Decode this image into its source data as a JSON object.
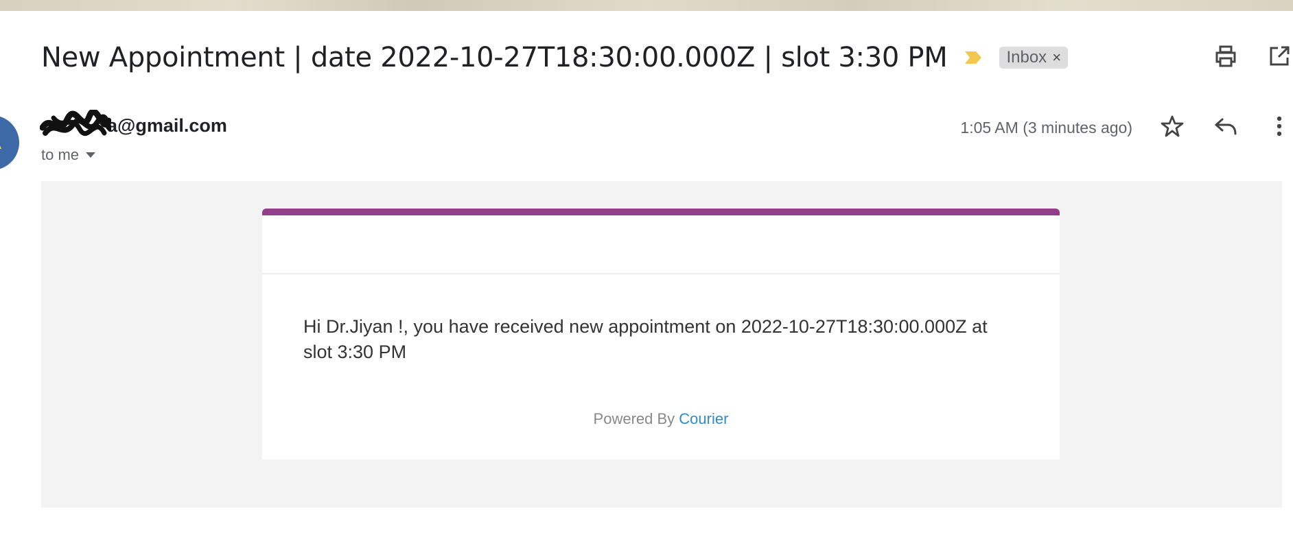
{
  "email": {
    "subject": "New Appointment | date 2022-10-27T18:30:00.000Z | slot 3:30 PM",
    "label": "Inbox",
    "label_remove": "×",
    "sender_email_suffix": "a@gmail.com",
    "recipient": "to me",
    "timestamp": "1:05 AM (3 minutes ago)",
    "avatar_initial": "A"
  },
  "body": {
    "message": "Hi Dr.Jiyan !, you have received new appointment on 2022-10-27T18:30:00.000Z at slot 3:30 PM",
    "powered_prefix": "Powered By",
    "powered_link": "Courier"
  },
  "colors": {
    "card_accent": "#913f88",
    "important_marker": "#f2c94c",
    "link": "#2e8ac9",
    "avatar_bg": "#3d6aa6"
  },
  "icons": {
    "print": "print-icon",
    "open_new_window": "open-in-new-window-icon",
    "star": "star-icon",
    "reply": "reply-icon",
    "more": "more-vertical-icon",
    "important": "importance-marker-icon"
  }
}
